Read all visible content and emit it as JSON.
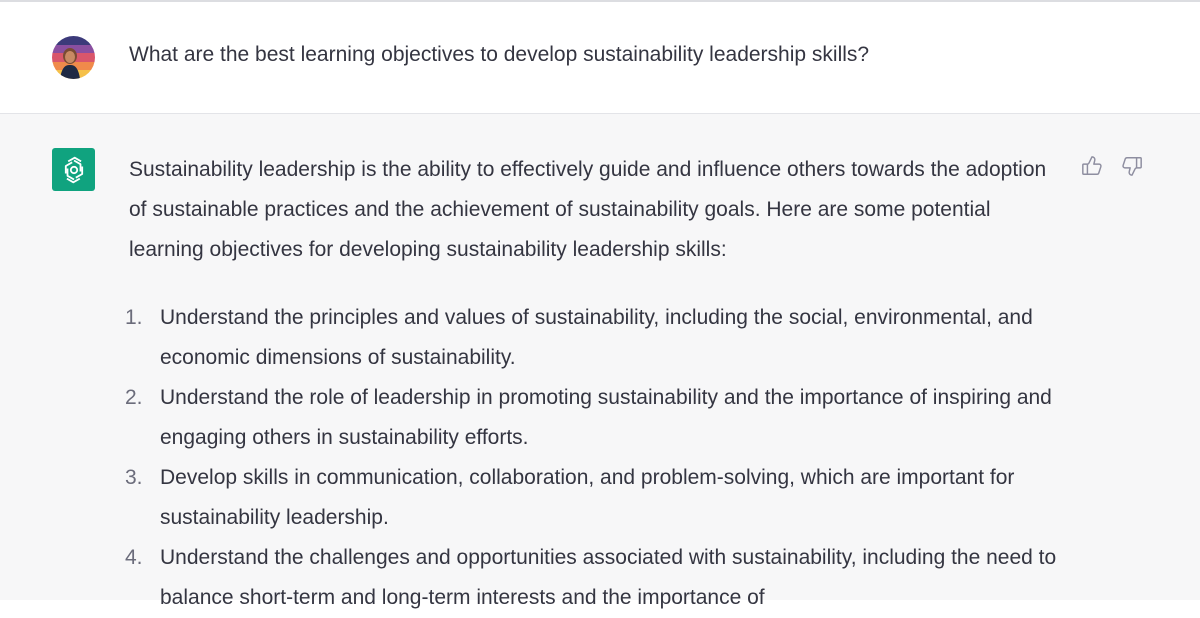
{
  "user": {
    "question": "What are the best learning objectives to develop sustainability leadership skills?"
  },
  "assistant": {
    "intro": "Sustainability leadership is the ability to effectively guide and influence others towards the adoption of sustainable practices and the achievement of sustainability goals. Here are some potential learning objectives for developing sustainability leadership skills:",
    "objectives": [
      {
        "num": "1.",
        "text": "Understand the principles and values of sustainability, including the social, environmental, and economic dimensions of sustainability."
      },
      {
        "num": "2.",
        "text": "Understand the role of leadership in promoting sustainability and the importance of inspiring and engaging others in sustainability efforts."
      },
      {
        "num": "3.",
        "text": "Develop skills in communication, collaboration, and problem-solving, which are important for sustainability leadership."
      },
      {
        "num": "4.",
        "text": "Understand the challenges and opportunities associated with sustainability, including the need to balance short-term and long-term interests and the importance of"
      }
    ]
  },
  "icons": {
    "avatar": "user-avatar",
    "assistant": "openai-logo-icon",
    "like": "thumbs-up-icon",
    "dislike": "thumbs-down-icon"
  },
  "colors": {
    "assistant_bg": "#f7f7f8",
    "logo_bg": "#10a37f",
    "text": "#343541"
  }
}
